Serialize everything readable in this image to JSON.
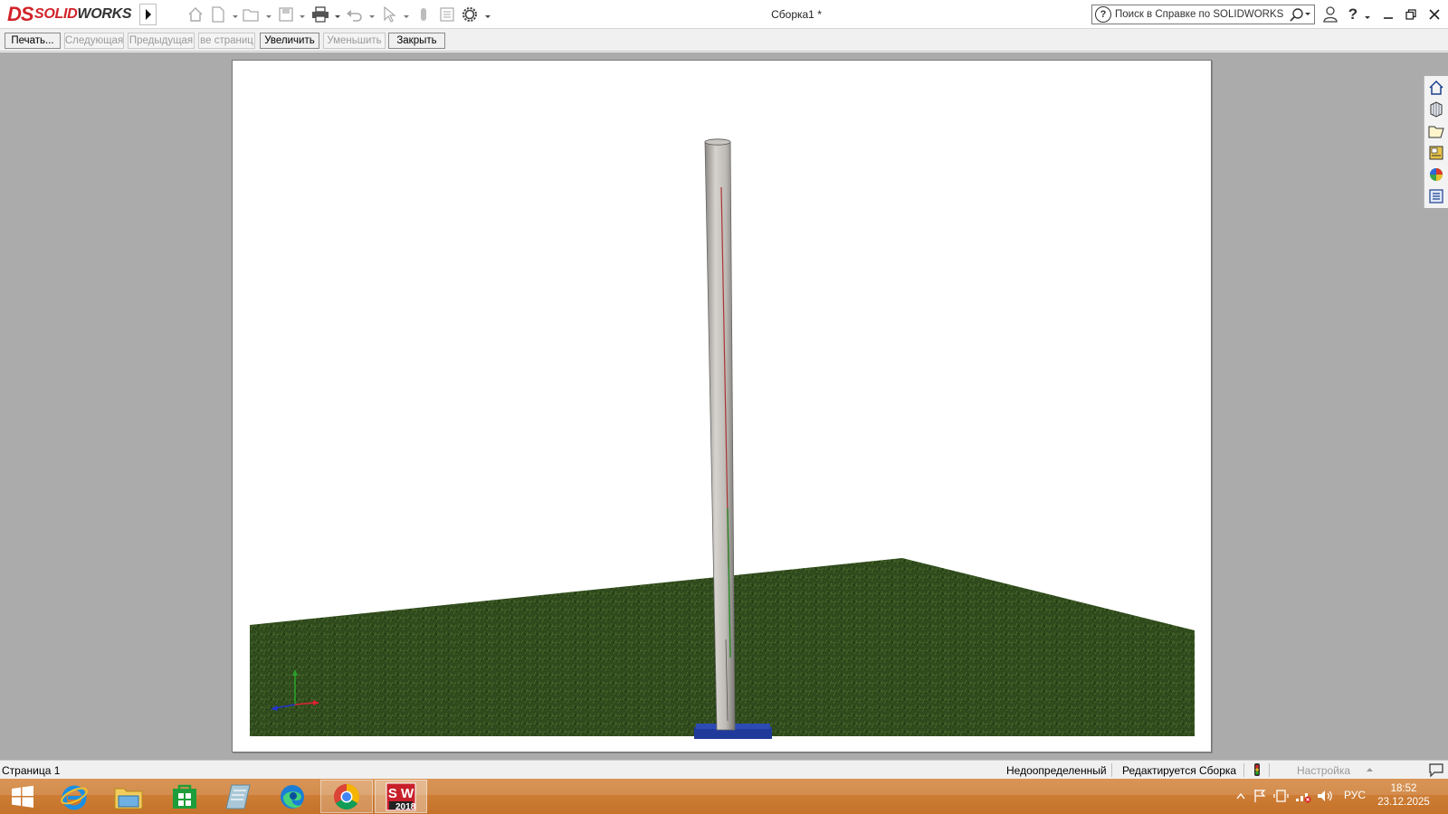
{
  "app": {
    "logo_prefix": "DS",
    "logo_name_red": "SOLID",
    "logo_name_dark": "WORKS",
    "document_title": "Сборка1 *"
  },
  "quick_access": {
    "icons": [
      "home-icon",
      "new-document-icon",
      "open-icon",
      "save-icon",
      "print-icon",
      "undo-icon",
      "select-icon",
      "rebuild-icon",
      "file-properties-icon",
      "options-icon"
    ]
  },
  "search": {
    "placeholder": "Поиск в Справке по SOLIDWORKS",
    "help_glyph": "?"
  },
  "window_controls": {
    "help": "?",
    "minimize": "—",
    "restore": "❐",
    "close": "✕"
  },
  "print_preview_toolbar": {
    "buttons": [
      {
        "label": "Печать...",
        "enabled": true
      },
      {
        "label": "Следующая",
        "enabled": false
      },
      {
        "label": "Предыдущая",
        "enabled": false
      },
      {
        "label": "ве страниц",
        "enabled": false
      },
      {
        "label": "Увеличить",
        "enabled": true
      },
      {
        "label": "Уменьшить",
        "enabled": false
      },
      {
        "label": "Закрыть",
        "enabled": true
      }
    ]
  },
  "scene": {
    "ground_color": "#2f4a1c",
    "pole_color": "#bdbab5",
    "base_color": "#1f3a9a"
  },
  "task_pane": {
    "tabs": [
      "solidworks-resources-icon",
      "design-library-icon",
      "file-explorer-icon",
      "view-palette-icon",
      "appearances-icon",
      "custom-properties-icon"
    ]
  },
  "status_bar": {
    "page": "Страница 1",
    "definition": "Недоопределенный",
    "editing": "Редактируется Сборка",
    "customize": "Настройка"
  },
  "taskbar": {
    "apps": [
      "windows-start-icon",
      "internet-explorer-icon",
      "file-explorer-icon",
      "microsoft-store-icon",
      "edge-icon",
      "chrome-icon",
      "solidworks-2018-icon"
    ],
    "sw_badge": "2018",
    "language": "РУС",
    "time": "18:52",
    "date": "23.12.2025"
  }
}
